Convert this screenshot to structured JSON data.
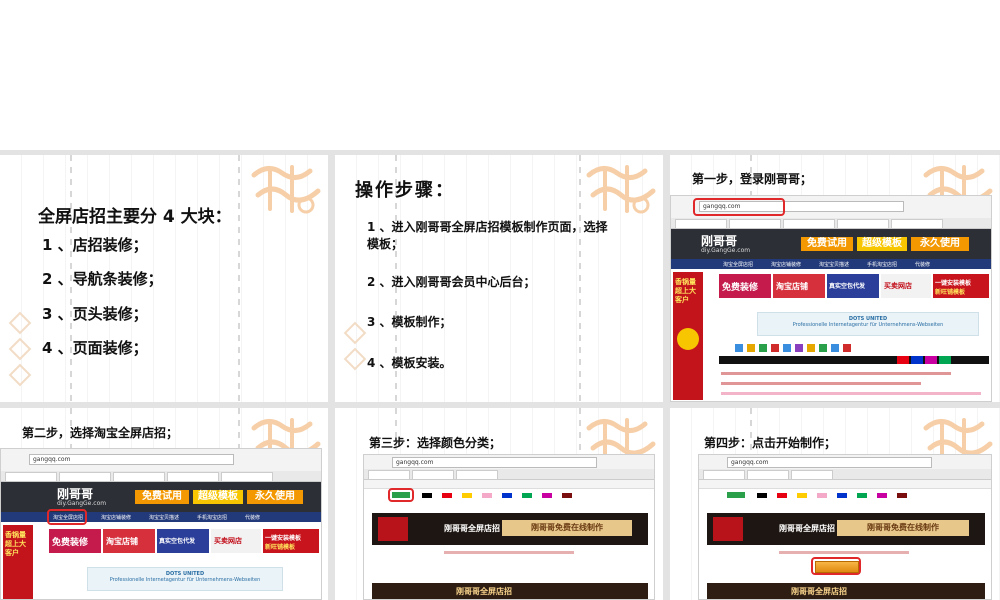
{
  "slide1": {
    "title": "全屏店招主要分 4 大块：",
    "items": [
      "1 、店招装修；",
      "2 、导航条装修；",
      "3 、页头装修；",
      "4 、页面装修；"
    ]
  },
  "slide2": {
    "heading": "操作步骤：",
    "steps": [
      "1 、进入刚哥哥全屏店招模板制作页面，选择",
      "模板；",
      "2 、进入刚哥哥会员中心后台；",
      "3 、模板制作；",
      "4 、模板安装。"
    ]
  },
  "slide3": {
    "caption": "第一步，登录刚哥哥；"
  },
  "slide4": {
    "caption": "第二步，选择淘宝全屏店招；"
  },
  "slide5": {
    "caption": "第三步：选择颜色分类；"
  },
  "slide6": {
    "caption": "第四步：点击开始制作；"
  },
  "site": {
    "url": "gangqq.com",
    "logo": "刚哥哥",
    "logo_sub": "diy.GangGe.com",
    "btn_free_trial": "免费试用",
    "btn_advanced": "超级模板",
    "btn_permanent": "永久使用",
    "banner_free_decor": "免费装修",
    "banner_taobao": "淘宝店铺",
    "banner_proxy": "真实空包代发",
    "banner_buy": "买卖网店",
    "banner_install": "一键安装模板",
    "banner_wangpu": "新旺铺模板",
    "ad": "DOTS UNITED",
    "ad_sub": "Professionelle Internetagentur für Unternehmens-Webseiten",
    "side_promo": "香锅量超上大客户",
    "template_title": "刚哥哥全屏店招",
    "template_cta": "刚哥哥免费在线制作"
  },
  "colors": {
    "accent_orange": "#f39800",
    "accent_yellow": "#f7c600",
    "nav_blue": "#233a7a",
    "highlight_red": "#e0282a",
    "swatches": [
      "#000000",
      "#e60012",
      "#ffcc00",
      "#f5a9c8",
      "#0033cc",
      "#00a651",
      "#c800a1",
      "#7a0e0e"
    ]
  }
}
